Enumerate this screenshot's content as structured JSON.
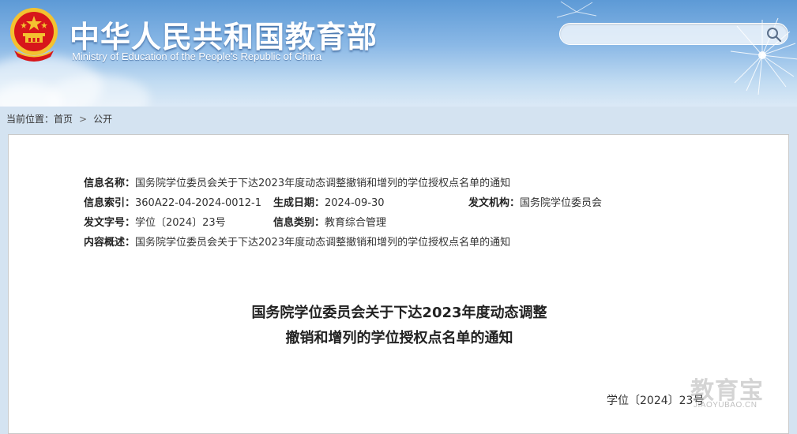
{
  "header": {
    "title": "中华人民共和国教育部",
    "subtitle": "Ministry of Education of the People's Republic of China",
    "search": {
      "value": "",
      "placeholder": ""
    },
    "search_icon": "magnifier-icon",
    "emblem": "national-emblem"
  },
  "breadcrumb": {
    "label": "当前位置：",
    "items": [
      "首页",
      "公开"
    ],
    "separator": ">"
  },
  "meta": {
    "name_label": "信息名称：",
    "name_value": "国务院学位委员会关于下达2023年度动态调整撤销和增列的学位授权点名单的通知",
    "index_label": "信息索引：",
    "index_value": "360A22-04-2024-0012-1",
    "date_label": "生成日期：",
    "date_value": "2024-09-30",
    "org_label": "发文机构：",
    "org_value": "国务院学位委员会",
    "docno_label": "发文字号：",
    "docno_value": "学位〔2024〕23号",
    "type_label": "信息类别：",
    "type_value": "教育综合管理",
    "summary_label": "内容概述：",
    "summary_value": "国务院学位委员会关于下达2023年度动态调整撤销和增列的学位授权点名单的通知"
  },
  "document": {
    "title_line1": "国务院学位委员会关于下达2023年度动态调整",
    "title_line2": "撤销和增列的学位授权点名单的通知",
    "number": "学位〔2024〕23号"
  },
  "watermark": {
    "cn": "教育宝",
    "en": "JIAOYUBAO.CN"
  },
  "colors": {
    "banner_top": "#5d9ad6",
    "banner_bottom": "#dbe9f6",
    "page_bg": "#d4e3f1",
    "emblem_red": "#d7161b",
    "emblem_gold": "#f3c230"
  }
}
